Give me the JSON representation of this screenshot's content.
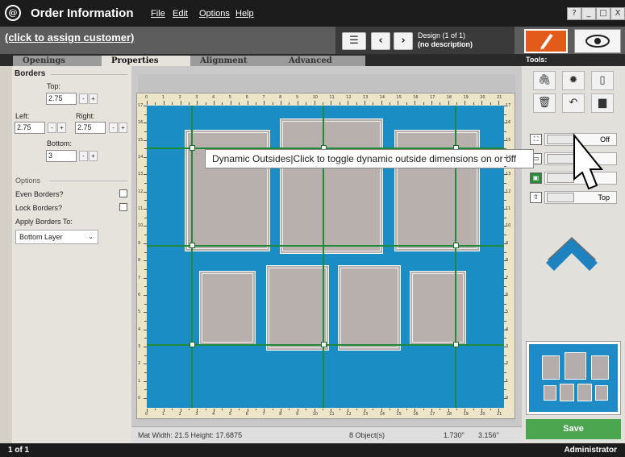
{
  "app": {
    "logo": "@",
    "title": "Order Information"
  },
  "menu": [
    "File",
    "Edit",
    "Options",
    "Help"
  ],
  "window_controls": [
    "?",
    "_",
    "□",
    "X"
  ],
  "customer": {
    "label": "(click to assign customer)"
  },
  "design": {
    "label": "Design  (1 of 1)",
    "description": "(no description)"
  },
  "tabs": [
    {
      "label": "Openings",
      "active": false
    },
    {
      "label": "Properties",
      "active": true
    },
    {
      "label": "Alignment",
      "active": false
    },
    {
      "label": "Advanced",
      "active": false
    }
  ],
  "tools_label": "Tools:",
  "borders": {
    "section": "Borders",
    "top_label": "Top:",
    "top": "2.75",
    "left_label": "Left:",
    "left": "2.75",
    "right_label": "Right:",
    "right": "2.75",
    "bottom_label": "Bottom:",
    "bottom": "3",
    "minus": "-",
    "plus": "+"
  },
  "options": {
    "section": "Options",
    "even_borders": "Even Borders?",
    "lock_borders": "Lock Borders?",
    "apply_label": "Apply Borders To:",
    "apply_value": "Bottom Layer"
  },
  "ruler": {
    "top_numbers": [
      "0",
      "1",
      "2",
      "3",
      "4",
      "5",
      "6",
      "7",
      "8",
      "9",
      "10",
      "11",
      "12",
      "13",
      "14",
      "15",
      "16",
      "17",
      "18",
      "19",
      "20",
      "21"
    ],
    "side_numbers": [
      "17",
      "16",
      "15",
      "14",
      "13",
      "12",
      "11",
      "10",
      "9",
      "8",
      "7",
      "6",
      "5",
      "4",
      "3",
      "2",
      "1",
      "0"
    ]
  },
  "tooltip": "Dynamic Outsides|Click to toggle dynamic outside dimensions on or off",
  "status": {
    "mat": "Mat  Width: 21.5  Height: 17.6875",
    "objects": "8 Object(s)",
    "x": "1.730\"",
    "y": "3.156\""
  },
  "toggles": [
    {
      "icon": "dynamic-outsides-icon",
      "value": "Off"
    },
    {
      "icon": "toggle-2-icon",
      "value": ""
    },
    {
      "icon": "toggle-3-icon",
      "value": ""
    },
    {
      "icon": "layer-up-icon",
      "value": "Top"
    }
  ],
  "save_label": "Save",
  "footer": {
    "page": "1 of 1",
    "user": "Administrator"
  },
  "colors": {
    "mat": "#1a8ec4",
    "opening": "#b8b0ad",
    "guide": "#1f8a3a",
    "save": "#4ba64f",
    "edit": "#e35b1b"
  }
}
